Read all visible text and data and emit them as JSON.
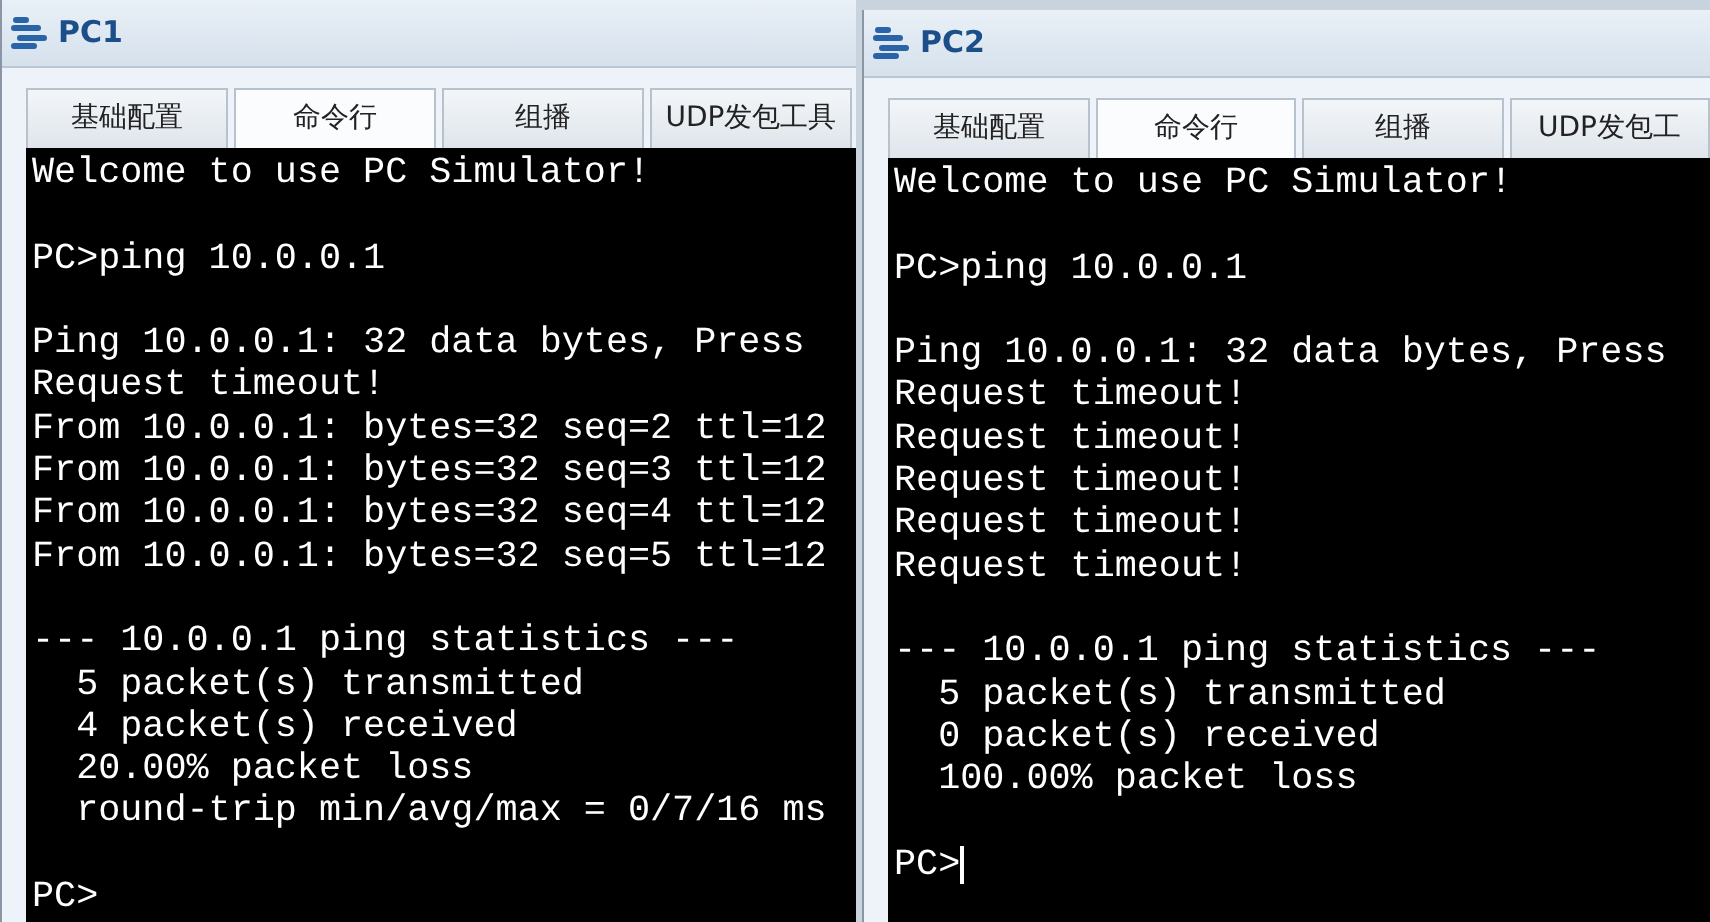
{
  "windows": [
    {
      "title": "PC1",
      "tabs": [
        {
          "label": "基础配置",
          "selected": false
        },
        {
          "label": "命令行",
          "selected": true
        },
        {
          "label": "组播",
          "selected": false
        },
        {
          "label": "UDP发包工具",
          "selected": false
        }
      ],
      "terminal": {
        "cursor": false,
        "blocks": [
          [
            "Welcome to use PC Simulator!"
          ],
          [
            "PC>ping 10.0.0.1"
          ],
          [
            "Ping 10.0.0.1: 32 data bytes, Press",
            "Request timeout!",
            "From 10.0.0.1: bytes=32 seq=2 ttl=12",
            "From 10.0.0.1: bytes=32 seq=3 ttl=12",
            "From 10.0.0.1: bytes=32 seq=4 ttl=12",
            "From 10.0.0.1: bytes=32 seq=5 ttl=12"
          ],
          [
            "--- 10.0.0.1 ping statistics ---",
            "  5 packet(s) transmitted",
            "  4 packet(s) received",
            "  20.00% packet loss",
            "  round-trip min/avg/max = 0/7/16 ms"
          ],
          [
            "PC>"
          ]
        ]
      }
    },
    {
      "title": "PC2",
      "tabs": [
        {
          "label": "基础配置",
          "selected": false
        },
        {
          "label": "命令行",
          "selected": true
        },
        {
          "label": "组播",
          "selected": false
        },
        {
          "label": "UDP发包工",
          "selected": false
        }
      ],
      "terminal": {
        "cursor": true,
        "blocks": [
          [
            "Welcome to use PC Simulator!"
          ],
          [
            "PC>ping 10.0.0.1"
          ],
          [
            "Ping 10.0.0.1: 32 data bytes, Press",
            "Request timeout!",
            "Request timeout!",
            "Request timeout!",
            "Request timeout!",
            "Request timeout!"
          ],
          [
            "--- 10.0.0.1 ping statistics ---",
            "  5 packet(s) transmitted",
            "  0 packet(s) received",
            "  100.00% packet loss"
          ],
          [
            "PC>"
          ]
        ]
      }
    }
  ]
}
